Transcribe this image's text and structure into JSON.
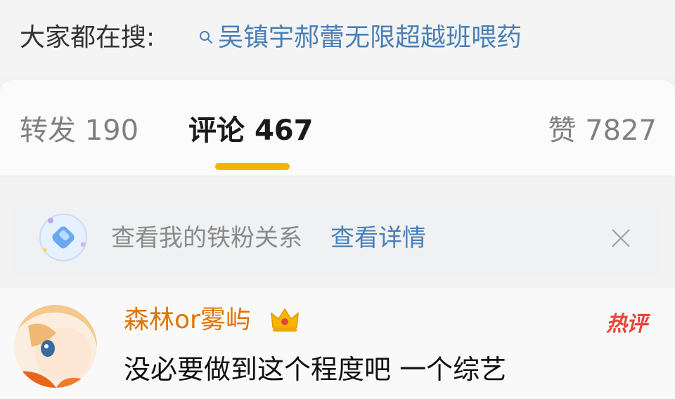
{
  "search": {
    "prefix": "大家都在搜:",
    "term": "吴镇宇郝蕾无限超越班喂药",
    "icon": "search-icon"
  },
  "tabs": {
    "repost": {
      "label": "转发",
      "count": "190"
    },
    "comments": {
      "label": "评论",
      "count": "467",
      "active": true
    },
    "likes": {
      "label": "赞",
      "count": "7827"
    }
  },
  "fan_banner": {
    "text": "查看我的铁粉关系",
    "link": "查看详情",
    "icons": [
      "fan-badge-icon",
      "close-icon"
    ]
  },
  "comment": {
    "username": "森林or雾屿",
    "badge": "热评",
    "text": "没必要做到这个程度吧 一个综艺",
    "icons": [
      "avatar",
      "crown-icon"
    ]
  },
  "colors": {
    "link": "#4a7fb5",
    "username": "#e07400",
    "tab_indicator": "#f5b400",
    "hot_badge": "#e8443a"
  }
}
